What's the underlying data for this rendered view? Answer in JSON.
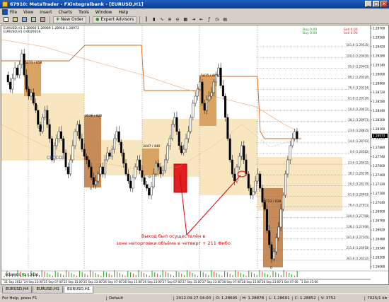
{
  "window": {
    "title": "67910: MetaTrader - FXintegralbank - [EURUSD,H1]",
    "minimize": "_",
    "maximize": "□",
    "close": "×"
  },
  "menu": [
    "File",
    "View",
    "Insert",
    "Charts",
    "Tools",
    "Window",
    "Help"
  ],
  "toolbar": {
    "new_order": "New Order",
    "expert_advisors": "Expert Advisors",
    "timeframes": [
      "M1",
      "M5",
      "M15",
      "M30",
      "H1",
      "H4",
      "D1",
      "W1",
      "MN"
    ]
  },
  "chart": {
    "symbol_line": "EURUSD,H1 1.28966 1.28989 1.28918 1.28973",
    "indicator_line": "EURUSD,H1 0.0029316",
    "box_labels": [
      "5271 / 658",
      "3536 / 825",
      "3447 / 440",
      "5415 / 409",
      "9723 / 628",
      "242",
      "0",
      "0",
      "0"
    ],
    "annotation_blue": "CBCCCB",
    "annotation_red_1": "Выход был осуществлён в",
    "annotation_red_2": "зоне наторговки объёма в четверг + 211 Фибо",
    "legend_top_right": [
      {
        "text": "Buy 0.00",
        "color": "#1a9a1a"
      },
      {
        "text": "Buy 0.00",
        "color": "#1a9a1a"
      },
      {
        "text": "Sell 0.00",
        "color": "#d02020"
      },
      {
        "text": "Sell 0.00",
        "color": "#d02020"
      }
    ],
    "fib_levels": [
      "161.8 (1.29535)",
      "100.0 (1.29450)",
      "95.0 (1.29401)",
      "88.2 (1.29320)",
      "76.4 (1.29214)",
      "61.8 (1.29120)",
      "50.0 (1.29072)",
      "38.2 (1.28971)",
      "23.6 (1.28835)",
      "14.6 (1.28761)",
      "0.0 (1.28582)",
      "23.6 (1.28432)",
      "38.2 (1.28278)",
      "50.0 (1.28179)",
      "61.8 (1.28063)",
      "76.4 (1.27951)",
      "100.0 (1.27768)",
      "138.2 (1.27466)",
      "161.8 (1.27305)",
      "211.8 (1.26918)",
      "261.8 (1.26522)"
    ],
    "price_ticks": [
      "1.29700",
      "1.29560",
      "1.29420",
      "1.29280",
      "1.29140",
      "1.29000",
      "1.28860",
      "1.28720",
      "1.28580",
      "1.28440",
      "1.28300",
      "1.28160",
      "1.28020",
      "1.27880",
      "1.27740",
      "1.27600",
      "1.27460",
      "1.27320",
      "1.27180",
      "1.27040",
      "1.26900",
      "1.26760",
      "1.26620",
      "1.26480",
      "1.26340",
      "1.26200",
      "1.26060"
    ],
    "last_price": "1.28973",
    "time_ticks": [
      "21 Sep 2012",
      "24 Sep 23:00",
      "25 Sep 07:00",
      "25 Sep 15:00",
      "25 Sep 23:00",
      "26 Sep 07:00",
      "26 Sep 15:00",
      "26 Sep 23:00",
      "27 Sep 07:00",
      "27 Sep 15:00",
      "27 Sep 23:00",
      "28 Sep 07:00",
      "28 Sep 15:00",
      "28 Sep 23:00",
      "1 Oct 07:00",
      "1 Oct 15:00"
    ],
    "subwindow_label": "VOLUMES_V2 0.2636"
  },
  "tabs": [
    "EURUSD,H4",
    "EURUSD,H1",
    "EURUSD,H1"
  ],
  "status": {
    "help": "For Help, press F1",
    "profile": "Default",
    "time": "2012.09.27 04:00",
    "open": "O: 1.28695",
    "high": "H: 1.28878",
    "low": "L: 1.28691",
    "close": "C: 1.28852",
    "volume": "V: 3752",
    "traffic": "7025/1 kb"
  }
}
